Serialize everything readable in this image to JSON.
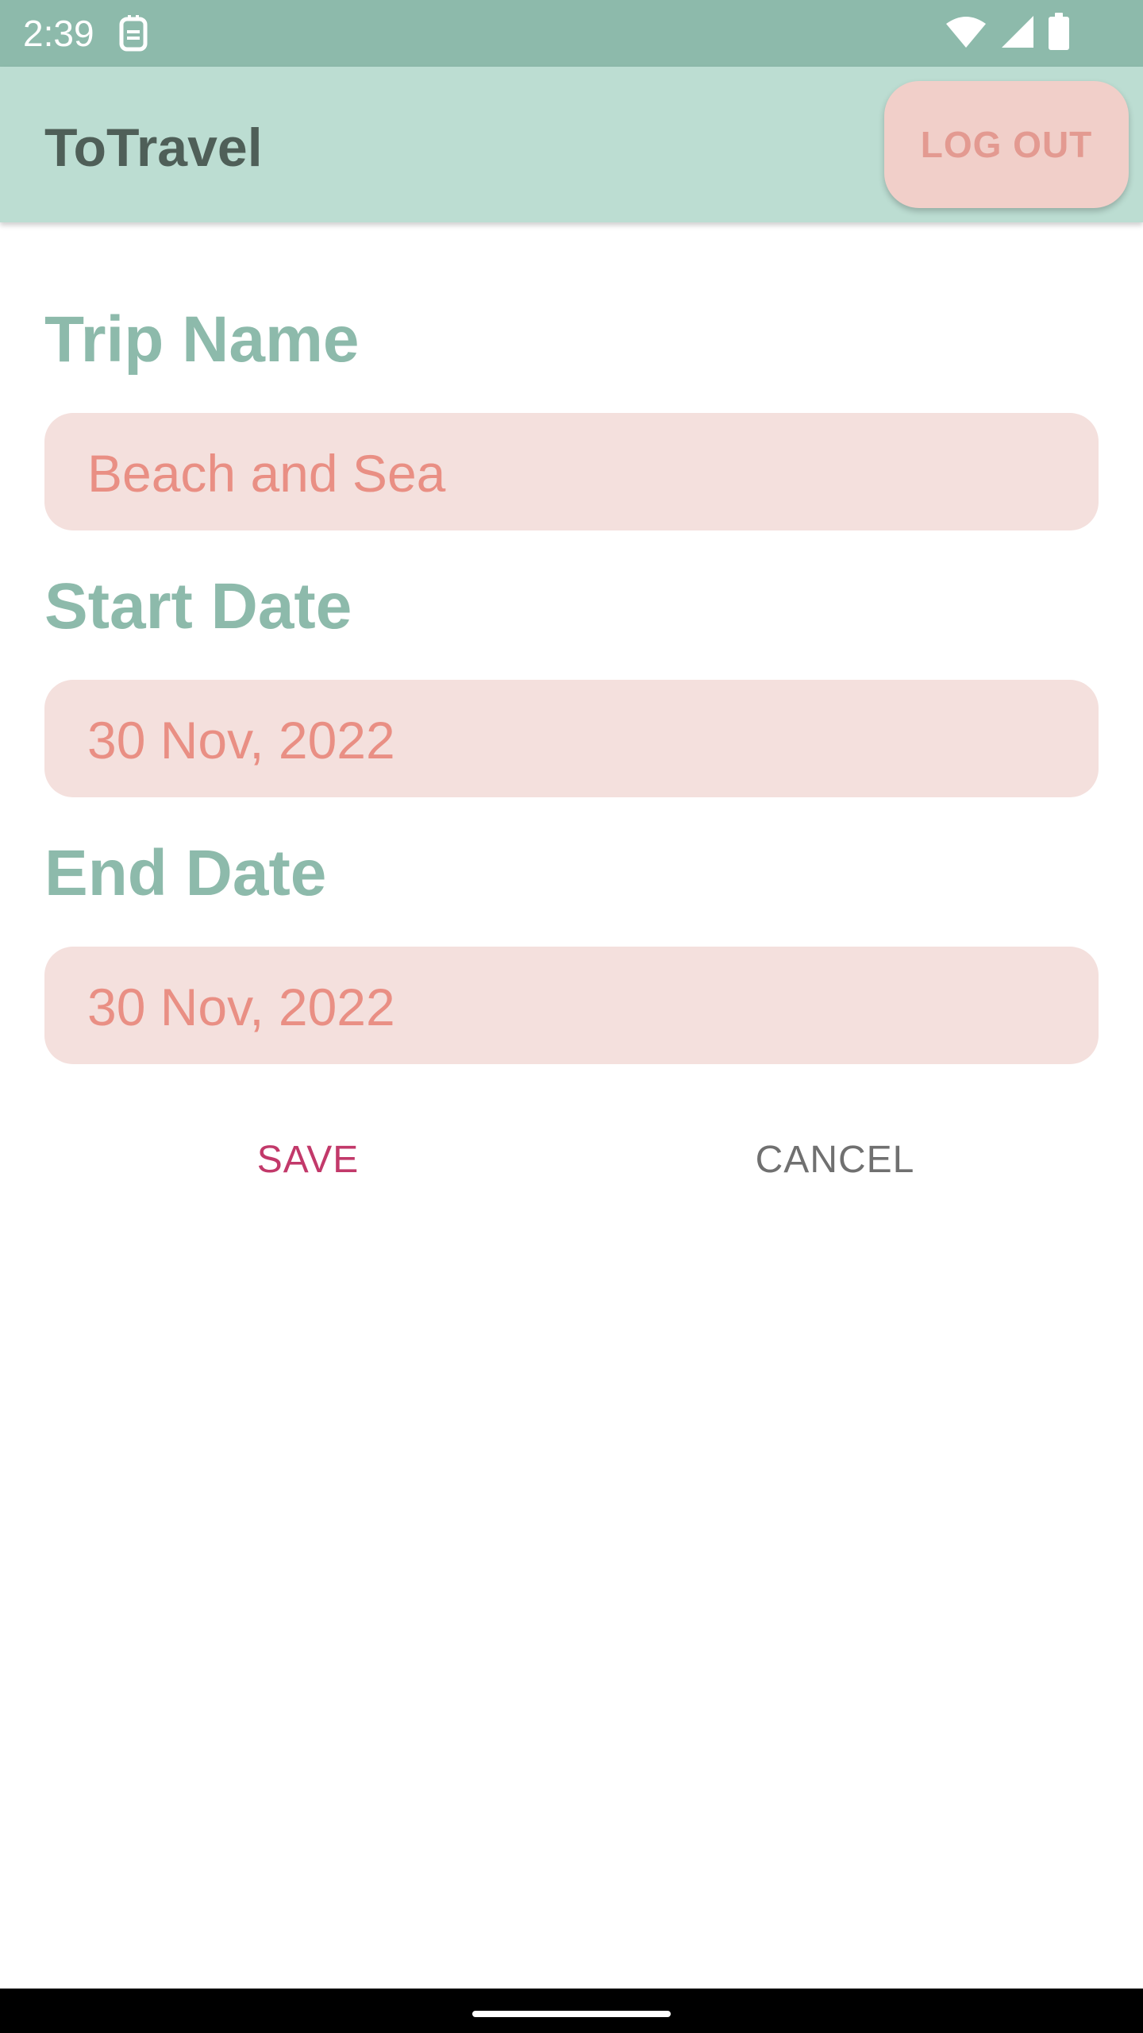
{
  "status_bar": {
    "time": "2:39",
    "left_icon": "sim-card-icon",
    "right_icons": [
      "wifi-icon",
      "cellular-signal-icon",
      "battery-icon"
    ]
  },
  "app_bar": {
    "title": "ToTravel",
    "logout_label": "LOG OUT"
  },
  "form": {
    "trip_name": {
      "label": "Trip Name",
      "value": "Beach and Sea"
    },
    "start_date": {
      "label": "Start Date",
      "value": "30 Nov, 2022"
    },
    "end_date": {
      "label": "End Date",
      "value": "30 Nov, 2022"
    }
  },
  "actions": {
    "save_label": "SAVE",
    "cancel_label": "CANCEL"
  },
  "colors": {
    "status_bar": "#8dbaab",
    "app_bar": "#bcddd2",
    "accent_label": "#8dbaab",
    "field_background": "#f4e0dd",
    "field_text": "#e98f84",
    "save_text": "#c2396a",
    "cancel_text": "#707070"
  }
}
